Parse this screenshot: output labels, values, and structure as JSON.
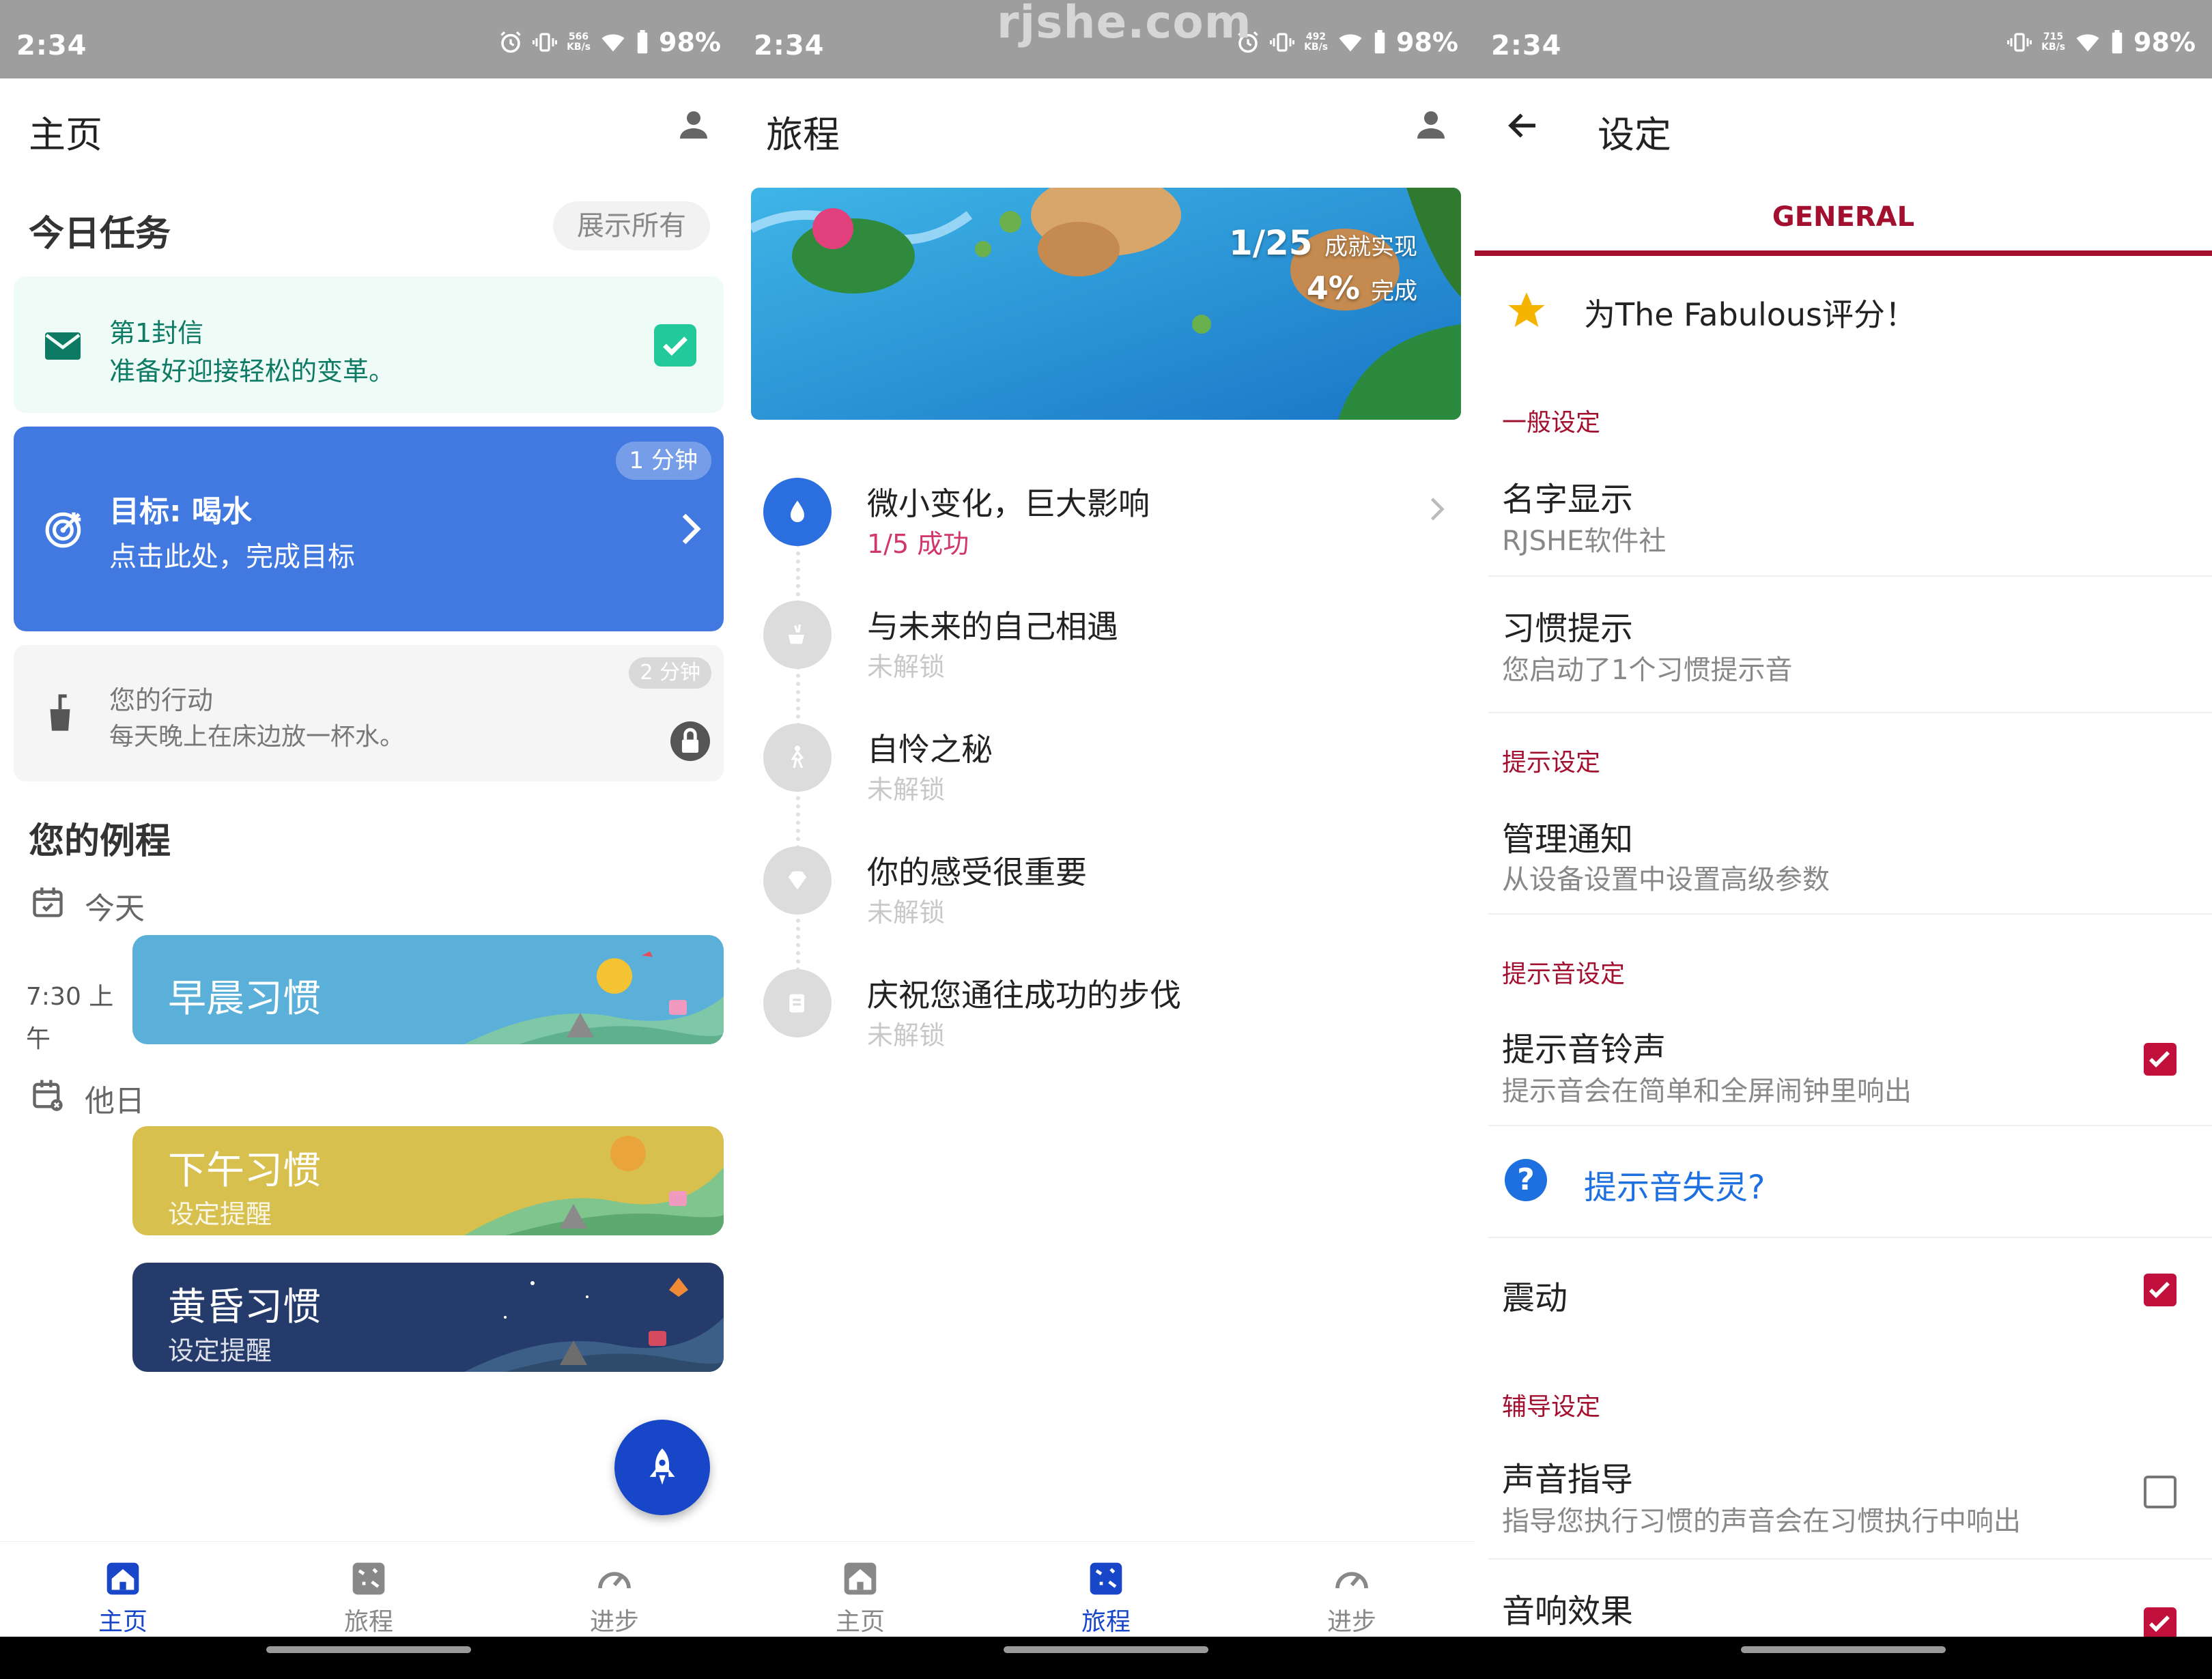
{
  "watermark": "rjshe.com",
  "status": {
    "s1": {
      "time": "2:34",
      "speed": "566\nKB/s",
      "battery": "98%"
    },
    "s2": {
      "time": "2:34",
      "speed": "492\nKB/s",
      "battery": "98%"
    },
    "s3": {
      "time": "2:34",
      "speed": "715\nKB/s",
      "battery": "98%"
    }
  },
  "home": {
    "title": "主页",
    "today_tasks": "今日任务",
    "show_all": "展示所有",
    "letter": {
      "title": "第1封信",
      "subtitle": "准备好迎接轻松的变革。"
    },
    "goal": {
      "title": "目标: 喝水",
      "subtitle": "点击此处，完成目标",
      "badge": "1 分钟"
    },
    "action": {
      "title": "您的行动",
      "subtitle": "每天晚上在床边放一杯水。",
      "badge": "2 分钟"
    },
    "routines_title": "您的例程",
    "today_label": "今天",
    "time_label": "7:30 上午",
    "other_label": "他日",
    "routines": [
      {
        "title": "早晨习惯",
        "subtitle": ""
      },
      {
        "title": "下午习惯",
        "subtitle": "设定提醒"
      },
      {
        "title": "黄昏习惯",
        "subtitle": "设定提醒"
      }
    ]
  },
  "journey": {
    "title": "旅程",
    "banner": {
      "achieved": "1/25",
      "achieved_label": "成就实现",
      "percent": "4%",
      "percent_label": "完成"
    },
    "items": [
      {
        "title": "微小变化，巨大影响",
        "status": "1/5 成功"
      },
      {
        "title": "与未来的自己相遇",
        "status": "未解锁"
      },
      {
        "title": "自怜之秘",
        "status": "未解锁"
      },
      {
        "title": "你的感受很重要",
        "status": "未解锁"
      },
      {
        "title": "庆祝您通往成功的步伐",
        "status": "未解锁"
      }
    ]
  },
  "settings": {
    "title": "设定",
    "tab": "GENERAL",
    "rate": "为The Fabulous评分！",
    "cat_general": "一般设定",
    "name_display": {
      "title": "名字显示",
      "value": "RJSHE软件社"
    },
    "habit_reminder": {
      "title": "习惯提示",
      "value": "您启动了1个习惯提示音"
    },
    "cat_reminder": "提示设定",
    "notifications": {
      "title": "管理通知",
      "value": "从设备设置中设置高级参数"
    },
    "cat_sound": "提示音设定",
    "ringtone": {
      "title": "提示音铃声",
      "value": "提示音会在简单和全屏闹钟里响出",
      "checked": true
    },
    "help": "提示音失灵?",
    "vibrate": {
      "title": "震动",
      "checked": true
    },
    "cat_coach": "辅导设定",
    "voice": {
      "title": "声音指导",
      "value": "指导您执行习惯的声音会在习惯执行中响出",
      "checked": false
    },
    "effects": {
      "title": "音响效果",
      "checked": true
    }
  },
  "nav": {
    "home": "主页",
    "journey": "旅程",
    "progress": "进步"
  },
  "colors": {
    "primary": "#1746c8",
    "accent": "#a3102f",
    "goal_card": "#4279e0",
    "letter_text": "#0d7a63",
    "checkbox": "#c2103d"
  }
}
